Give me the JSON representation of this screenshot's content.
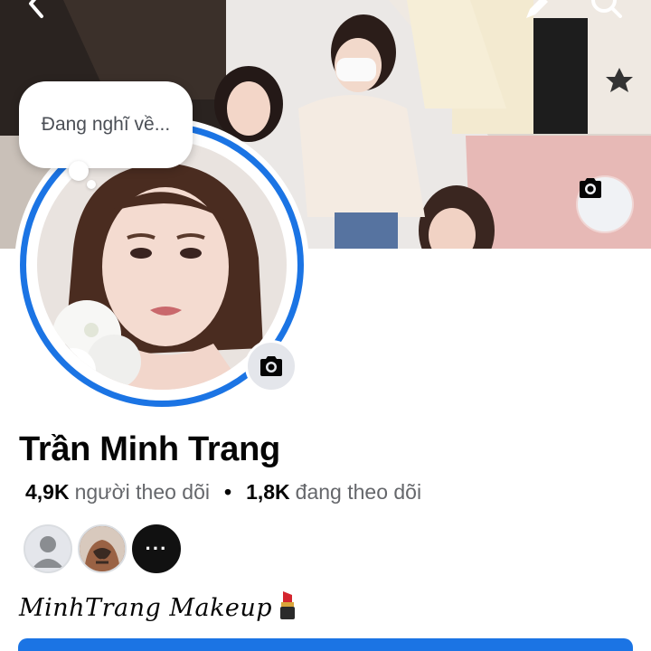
{
  "profile": {
    "name": "Trần Minh Trang",
    "thought_placeholder": "Đang nghĩ về...",
    "followers_count": "4,9K",
    "followers_label": "người theo dõi",
    "separator": "•",
    "following_count": "1,8K",
    "following_label": "đang theo dõi",
    "bio": "MinhTrang Makeup",
    "more_friends_glyph": "···"
  },
  "icons": {
    "back": "chevron-left-icon",
    "search": "search-icon",
    "edit": "pencil-icon",
    "cover_camera": "camera-icon",
    "avatar_camera": "camera-icon",
    "bio_emoji": "lipstick-icon"
  },
  "colors": {
    "accent": "#1b74e4",
    "text_primary": "#050505",
    "text_secondary": "#65676b"
  }
}
